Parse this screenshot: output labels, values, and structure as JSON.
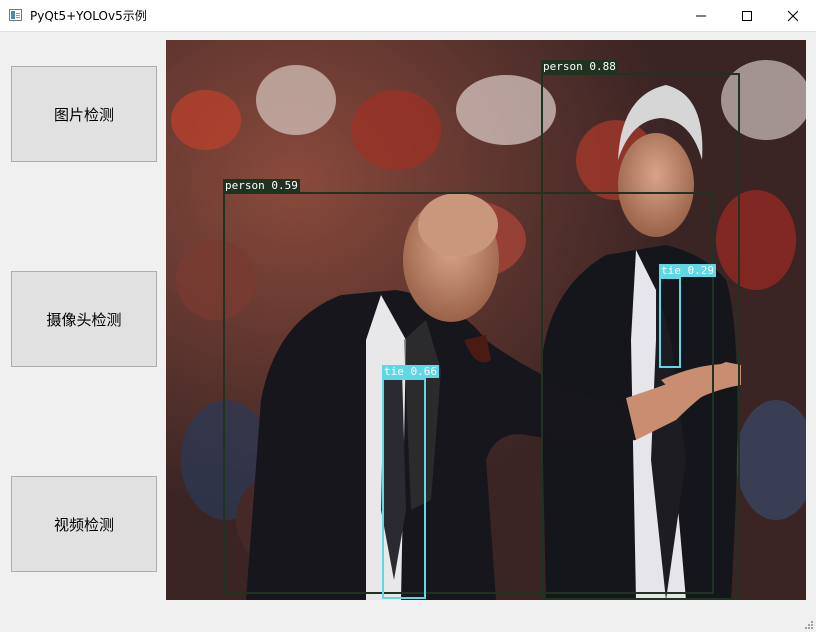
{
  "window": {
    "title": "PyQt5+YOLOv5示例"
  },
  "buttons": {
    "image_detect": "图片检测",
    "camera_detect": "摄像头检测",
    "video_detect": "视频检测"
  },
  "detections": [
    {
      "label": "person",
      "confidence": "0.88",
      "text": "person 0.88",
      "color": "#1f3320"
    },
    {
      "label": "person",
      "confidence": "0.59",
      "text": "person 0.59",
      "color": "#1f3320"
    },
    {
      "label": "tie",
      "confidence": "0.29",
      "text": "tie 0.29",
      "color": "#5fd8e6"
    },
    {
      "label": "tie",
      "confidence": "0.66",
      "text": "tie 0.66",
      "color": "#5fd8e6"
    }
  ]
}
